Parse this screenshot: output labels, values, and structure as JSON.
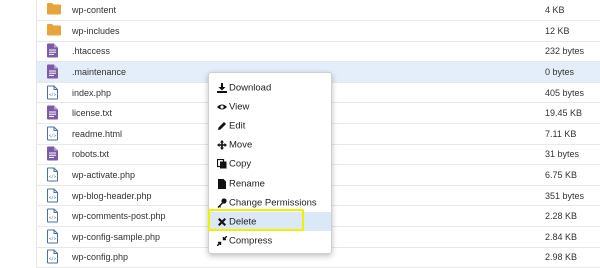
{
  "files": [
    {
      "name": "wp-content",
      "size": "4 KB",
      "type": "folder"
    },
    {
      "name": "wp-includes",
      "size": "12 KB",
      "type": "folder"
    },
    {
      "name": ".htaccess",
      "size": "232 bytes",
      "type": "text"
    },
    {
      "name": ".maintenance",
      "size": "0 bytes",
      "type": "text",
      "selected": true
    },
    {
      "name": "index.php",
      "size": "405 bytes",
      "type": "php"
    },
    {
      "name": "license.txt",
      "size": "19.45 KB",
      "type": "text"
    },
    {
      "name": "readme.html",
      "size": "7.11 KB",
      "type": "html"
    },
    {
      "name": "robots.txt",
      "size": "31 bytes",
      "type": "text"
    },
    {
      "name": "wp-activate.php",
      "size": "6.75 KB",
      "type": "php"
    },
    {
      "name": "wp-blog-header.php",
      "size": "351 bytes",
      "type": "php"
    },
    {
      "name": "wp-comments-post.php",
      "size": "2.28 KB",
      "type": "php"
    },
    {
      "name": "wp-config-sample.php",
      "size": "2.84 KB",
      "type": "php"
    },
    {
      "name": "wp-config.php",
      "size": "2.98 KB",
      "type": "php"
    }
  ],
  "context_menu": {
    "items": [
      {
        "label": "Download",
        "icon": "download-icon"
      },
      {
        "label": "View",
        "icon": "eye-icon"
      },
      {
        "label": "Edit",
        "icon": "pencil-icon"
      },
      {
        "label": "Move",
        "icon": "move-icon"
      },
      {
        "label": "Copy",
        "icon": "copy-icon"
      },
      {
        "label": "Rename",
        "icon": "rename-icon"
      },
      {
        "label": "Change Permissions",
        "icon": "key-icon"
      },
      {
        "label": "Delete",
        "icon": "x-icon",
        "hover": true
      },
      {
        "label": "Compress",
        "icon": "compress-icon"
      }
    ]
  },
  "colors": {
    "folder": "#e8a33c",
    "text_file": "#7d5ba6",
    "php_file": "#4a6fa5",
    "selected_row": "#e3eefa",
    "highlight_box": "#f0f000",
    "menu_hover": "#dbe8f6"
  }
}
